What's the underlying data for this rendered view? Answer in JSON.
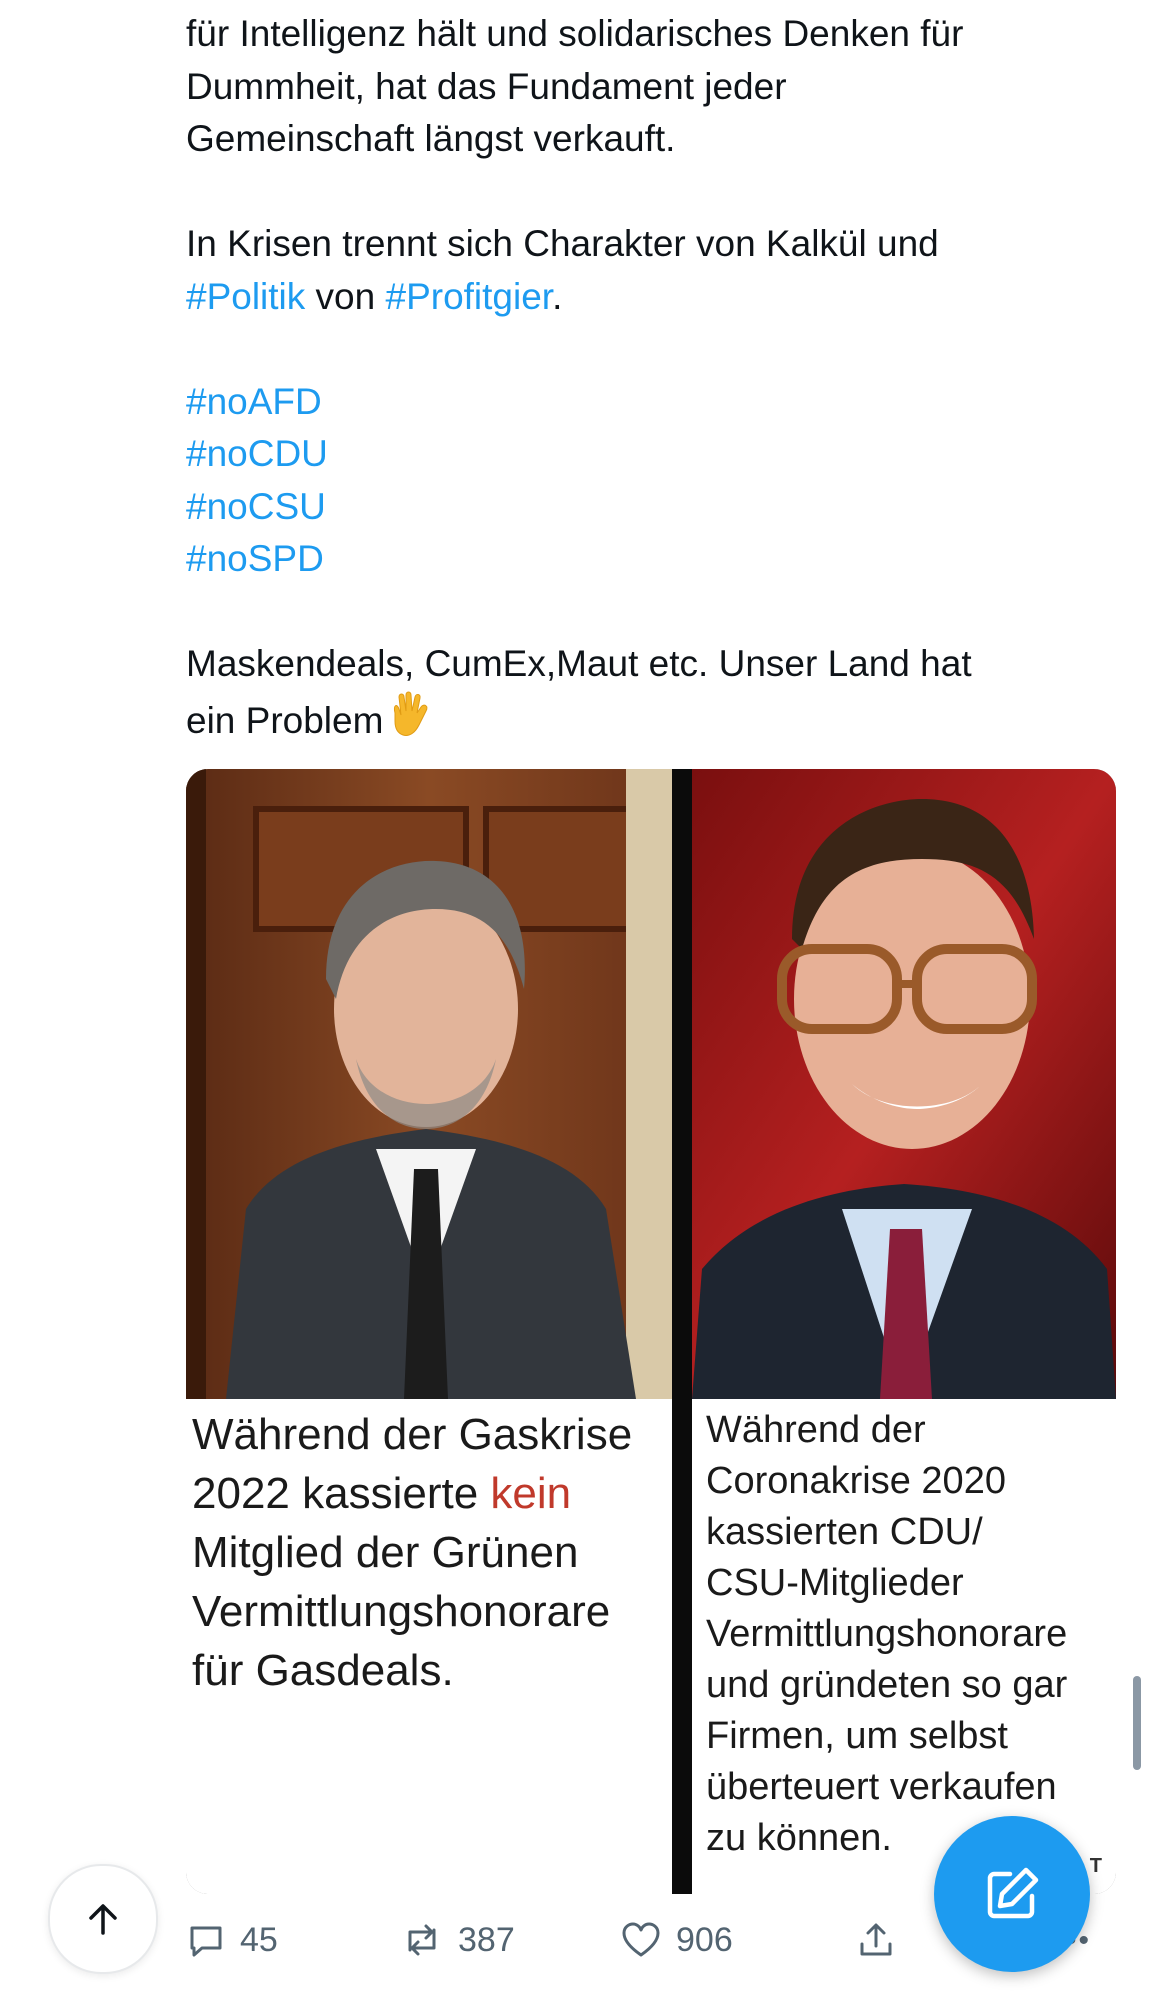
{
  "tweet": {
    "lines": [
      "für Intelligenz hält und solidarisches Denken für",
      "Dummheit, hat das Fundament jeder",
      "Gemeinschaft längst verkauft."
    ],
    "crisis_prefix": "In Krisen trennt sich Charakter von Kalkül und",
    "politik_tag": "#Politik",
    "von_word": " von ",
    "profitgier_tag": "#Profitgier",
    "period": ".",
    "hashtags": [
      "#noAFD",
      "#noCDU",
      "#noCSU",
      "#noSPD"
    ],
    "problem_line1": "Maskendeals, CumEx,Maut etc. Unser Land hat",
    "problem_line2": "ein Problem",
    "hand_emoji": "vulcan-salute-emoji"
  },
  "media": {
    "left_caption": [
      "Während der Gaskrise",
      "2022 kassierte ",
      "kein",
      "Mitglied der Grünen",
      "Vermittlungshonorare",
      "für Gasdeals."
    ],
    "right_caption": [
      "Während der",
      "Coronakrise 2020",
      "kassierten CDU/",
      "CSU-Mitglieder",
      "Vermittlungshonorare",
      "und gründeten so gar",
      "Firmen, um selbst",
      "überteuert verkaufen",
      "zu können."
    ],
    "watermark": "T"
  },
  "actions": {
    "replies": "45",
    "reposts": "387",
    "likes": "906"
  },
  "colors": {
    "link": "#1d9bf0",
    "fab": "#1d9bf0",
    "caption_highlight": "#c0392b",
    "muted": "#536471"
  }
}
